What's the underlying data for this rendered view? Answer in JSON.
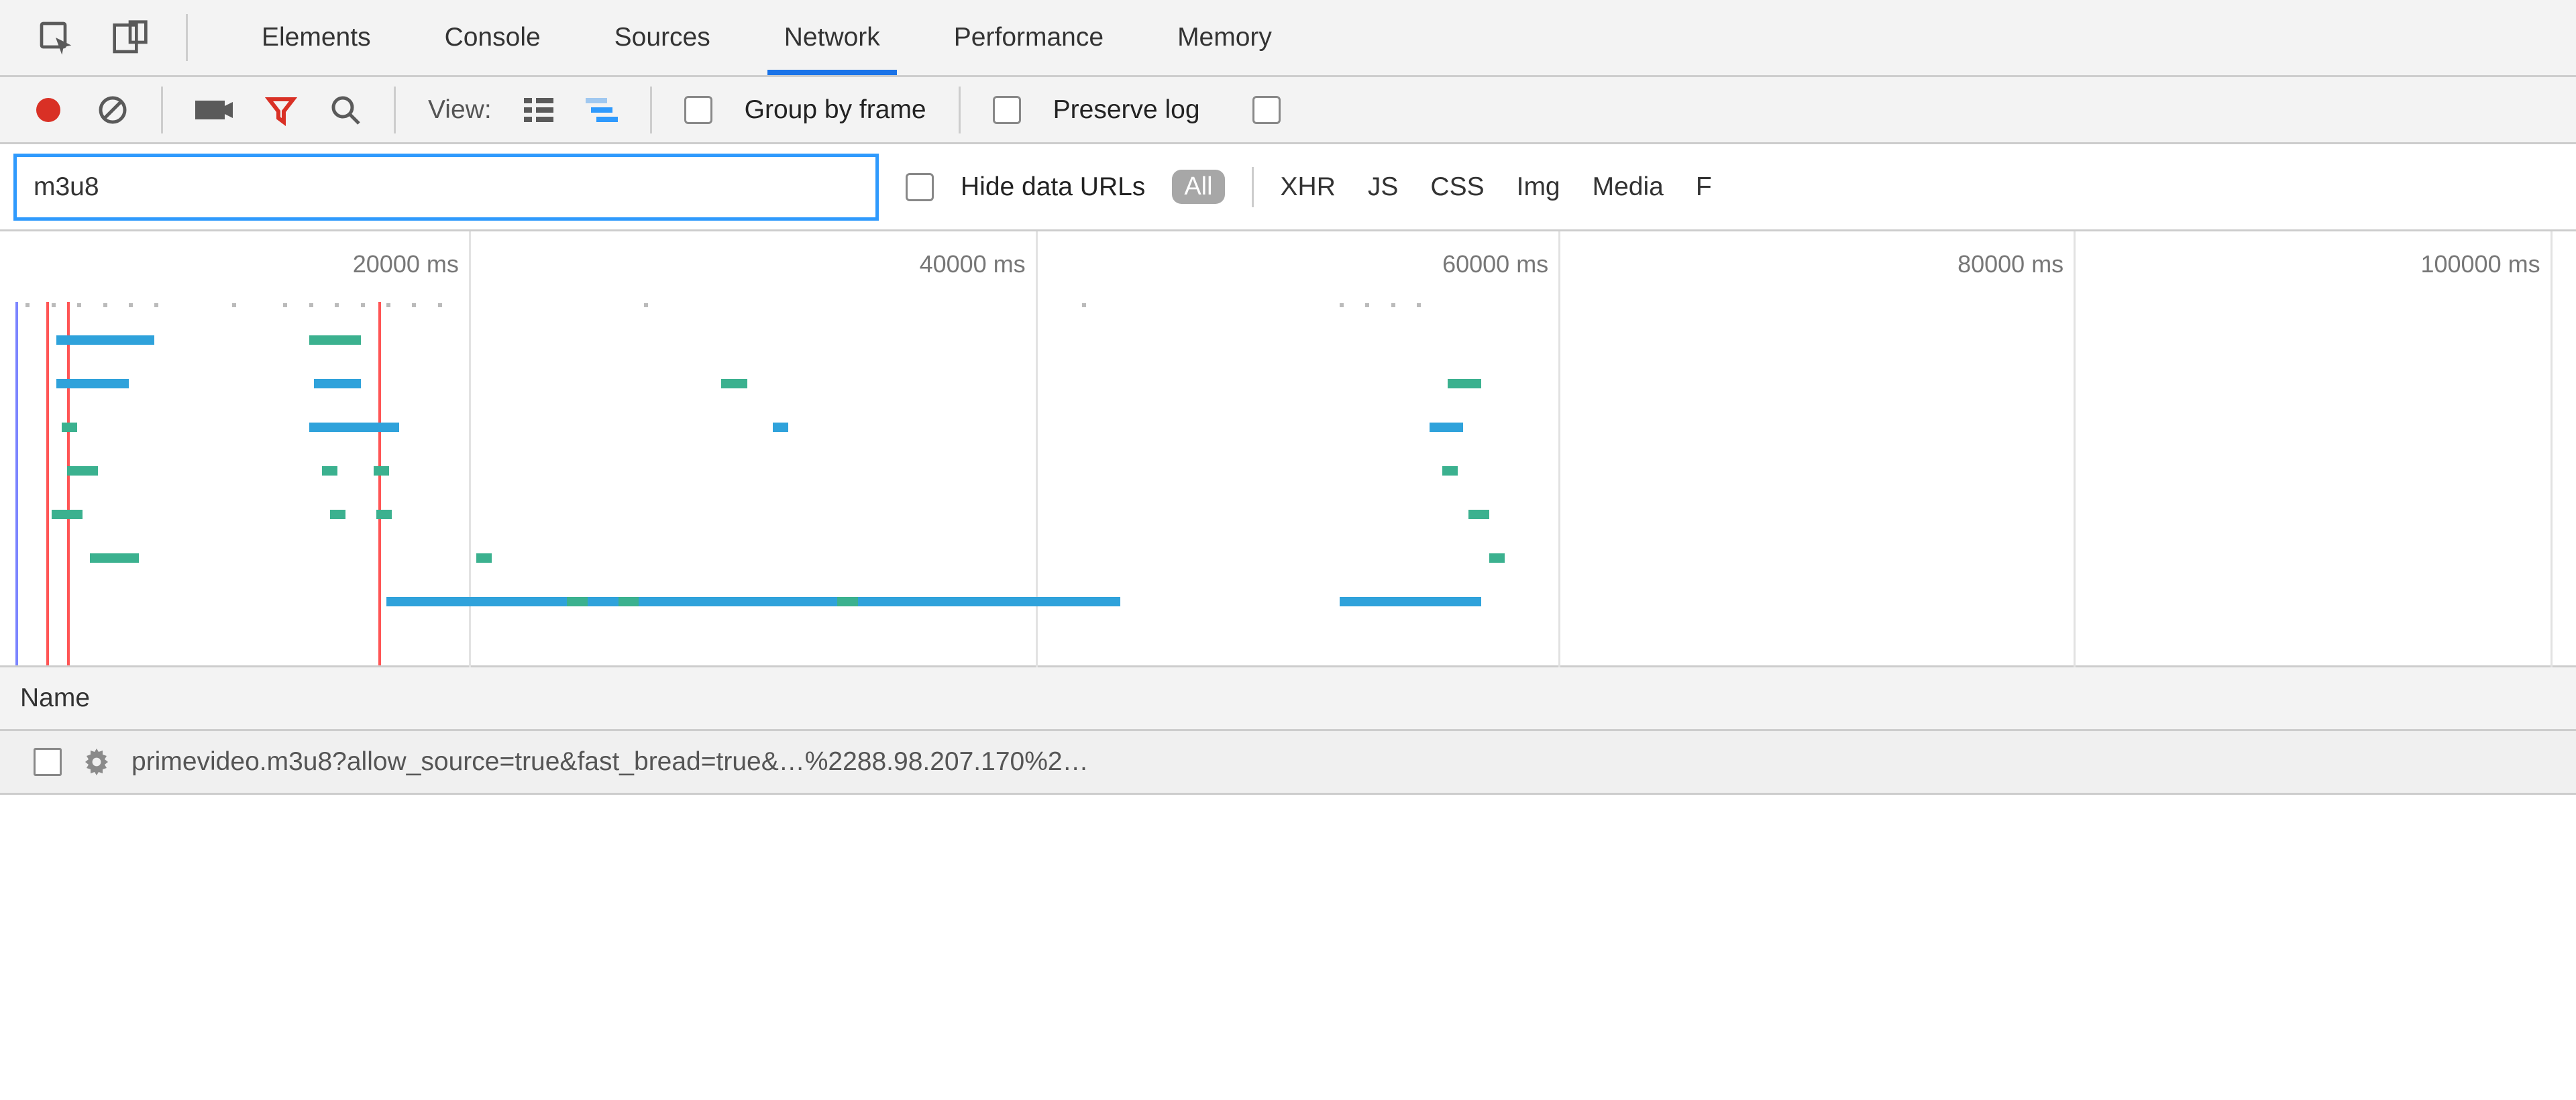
{
  "tabs": {
    "items": [
      {
        "label": "Elements",
        "active": false
      },
      {
        "label": "Console",
        "active": false
      },
      {
        "label": "Sources",
        "active": false
      },
      {
        "label": "Network",
        "active": true
      },
      {
        "label": "Performance",
        "active": false
      },
      {
        "label": "Memory",
        "active": false
      }
    ]
  },
  "toolbar": {
    "view_label": "View:",
    "group_by_frame_label": "Group by frame",
    "preserve_log_label": "Preserve log"
  },
  "filter": {
    "value": "m3u8",
    "hide_data_urls_label": "Hide data URLs",
    "all_label": "All",
    "types": [
      "XHR",
      "JS",
      "CSS",
      "Img",
      "Media",
      "F"
    ]
  },
  "timeline": {
    "ticks": [
      {
        "label": "20000 ms",
        "pct": 18.2
      },
      {
        "label": "40000 ms",
        "pct": 40.2
      },
      {
        "label": "60000 ms",
        "pct": 60.5
      },
      {
        "label": "80000 ms",
        "pct": 80.5
      },
      {
        "label": "100000 ms",
        "pct": 99.0
      }
    ],
    "red_lines_pct": [
      1.8,
      2.6,
      14.7
    ],
    "blue_lines_pct": [
      0.6
    ],
    "bars": [
      {
        "row": 0,
        "start": 2.2,
        "end": 6.0,
        "color": "blue"
      },
      {
        "row": 0,
        "start": 12.0,
        "end": 14.0,
        "color": "green"
      },
      {
        "row": 1,
        "start": 2.2,
        "end": 5.0,
        "color": "blue"
      },
      {
        "row": 1,
        "start": 12.2,
        "end": 14.0,
        "color": "blue"
      },
      {
        "row": 1,
        "start": 28.0,
        "end": 29.0,
        "color": "green"
      },
      {
        "row": 1,
        "start": 56.2,
        "end": 57.5,
        "color": "green"
      },
      {
        "row": 2,
        "start": 2.4,
        "end": 3.0,
        "color": "green"
      },
      {
        "row": 2,
        "start": 12.0,
        "end": 15.5,
        "color": "blue"
      },
      {
        "row": 2,
        "start": 30.0,
        "end": 30.6,
        "color": "blue"
      },
      {
        "row": 2,
        "start": 55.5,
        "end": 56.8,
        "color": "blue"
      },
      {
        "row": 3,
        "start": 2.6,
        "end": 3.8,
        "color": "green"
      },
      {
        "row": 3,
        "start": 12.5,
        "end": 13.1,
        "color": "green"
      },
      {
        "row": 3,
        "start": 14.5,
        "end": 15.1,
        "color": "green"
      },
      {
        "row": 3,
        "start": 56.0,
        "end": 56.6,
        "color": "green"
      },
      {
        "row": 4,
        "start": 2.0,
        "end": 3.2,
        "color": "green"
      },
      {
        "row": 4,
        "start": 12.8,
        "end": 13.4,
        "color": "green"
      },
      {
        "row": 4,
        "start": 14.6,
        "end": 15.2,
        "color": "green"
      },
      {
        "row": 4,
        "start": 57.0,
        "end": 57.8,
        "color": "green"
      },
      {
        "row": 5,
        "start": 3.5,
        "end": 5.4,
        "color": "green"
      },
      {
        "row": 5,
        "start": 18.5,
        "end": 19.1,
        "color": "green"
      },
      {
        "row": 5,
        "start": 57.8,
        "end": 58.4,
        "color": "green"
      },
      {
        "row": 6,
        "start": 15.0,
        "end": 43.5,
        "color": "blue"
      },
      {
        "row": 6,
        "start": 22.0,
        "end": 22.8,
        "color": "green"
      },
      {
        "row": 6,
        "start": 24.0,
        "end": 24.8,
        "color": "green"
      },
      {
        "row": 6,
        "start": 32.5,
        "end": 33.3,
        "color": "green"
      },
      {
        "row": 6,
        "start": 52.0,
        "end": 57.5,
        "color": "blue"
      }
    ],
    "top_ticks_pct": [
      1,
      2,
      3,
      4,
      5,
      6,
      9,
      11,
      12,
      13,
      14,
      15,
      16,
      17,
      25,
      42,
      52,
      53,
      54,
      55
    ]
  },
  "table": {
    "header_label": "Name",
    "rows": [
      {
        "name": "primevideo.m3u8?allow_source=true&fast_bread=true&…%2288.98.207.170%2…"
      }
    ]
  }
}
